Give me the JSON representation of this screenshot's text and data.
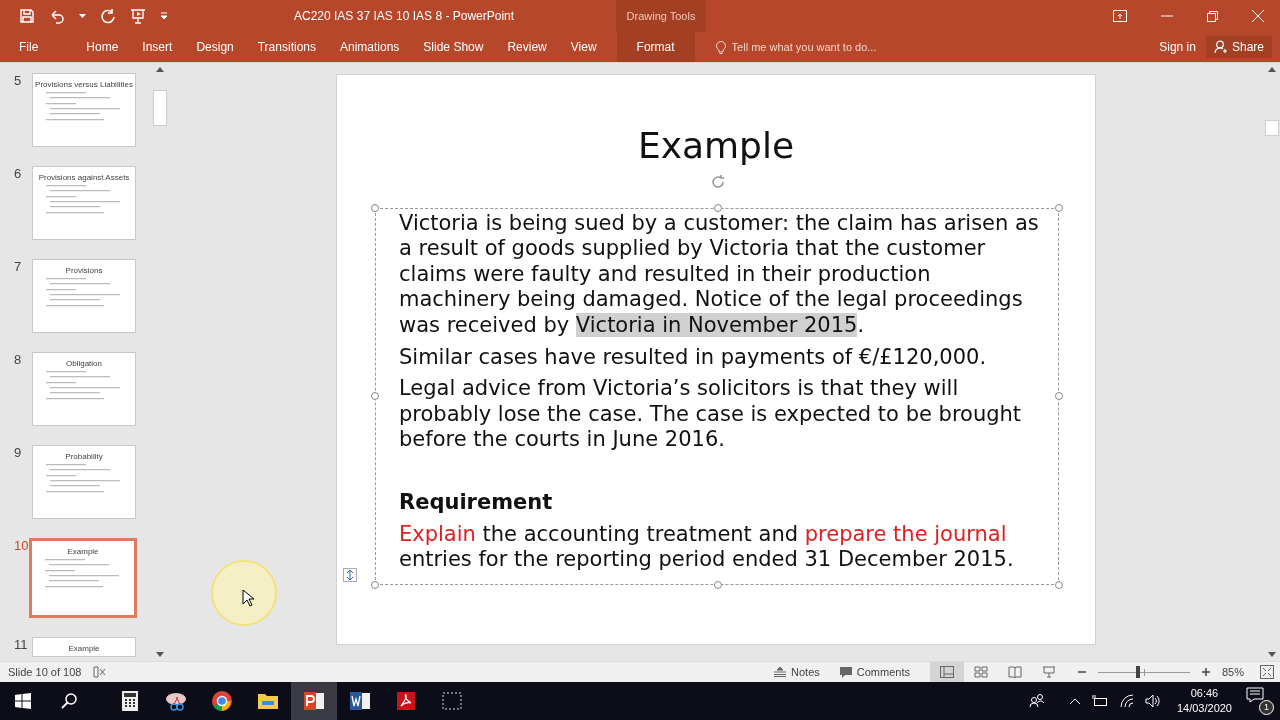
{
  "window": {
    "title": "AC220 IAS 37 IAS 10 IAS 8 - PowerPoint",
    "context_label": "Drawing Tools"
  },
  "ribbon_tabs": [
    {
      "label": "File",
      "selected": false
    },
    {
      "label": "Home",
      "selected": false
    },
    {
      "label": "Insert",
      "selected": false
    },
    {
      "label": "Design",
      "selected": false
    },
    {
      "label": "Transitions",
      "selected": false
    },
    {
      "label": "Animations",
      "selected": false
    },
    {
      "label": "Slide Show",
      "selected": false
    },
    {
      "label": "Review",
      "selected": false
    },
    {
      "label": "View",
      "selected": false
    },
    {
      "label": "Format",
      "selected": true
    }
  ],
  "tell_me": {
    "placeholder": "Tell me what you want to do..."
  },
  "sign_in": "Sign in",
  "share": "Share",
  "thumbnails": [
    {
      "number": "5",
      "title": "Provisions versus Liabilities",
      "selected": false
    },
    {
      "number": "6",
      "title": "Provisions against Assets",
      "selected": false
    },
    {
      "number": "7",
      "title": "Provisions",
      "selected": false
    },
    {
      "number": "8",
      "title": "Obligation",
      "selected": false
    },
    {
      "number": "9",
      "title": "Probability",
      "selected": false
    },
    {
      "number": "10",
      "title": "Example",
      "selected": true
    },
    {
      "number": "11",
      "title": "Example",
      "selected": false
    }
  ],
  "slide": {
    "title": "Example",
    "paragraphs": [
      {
        "kind": "body",
        "runs": [
          {
            "text": "Victoria is being sued by a customer: the claim has arisen as a result of goods supplied by Victoria that the customer claims were faulty and resulted in their production machinery being damaged. Notice of the legal proceedings was received by ",
            "kind": "plain"
          },
          {
            "text": "Victoria in November 2015",
            "kind": "highlight"
          },
          {
            "text": ".",
            "kind": "plain"
          }
        ]
      },
      {
        "kind": "body",
        "runs": [
          {
            "text": "Similar cases have resulted in payments of €/£120,000.",
            "kind": "plain"
          }
        ]
      },
      {
        "kind": "body",
        "runs": [
          {
            "text": "Legal advice from Victoria’s solicitors is that they will probably lose the case. The case is expected to be brought before the courts in June 2016.",
            "kind": "plain"
          }
        ]
      },
      {
        "kind": "heading",
        "runs": [
          {
            "text": "Requirement",
            "kind": "plain"
          }
        ]
      },
      {
        "kind": "body",
        "runs": [
          {
            "text": "Explain",
            "kind": "accent"
          },
          {
            "text": " the accounting treatment and ",
            "kind": "plain"
          },
          {
            "text": "prepare the journal",
            "kind": "accent"
          },
          {
            "text": " entries for the reporting period ended 31 December 2015.",
            "kind": "plain"
          }
        ]
      }
    ]
  },
  "status_bar": {
    "slide_info": "Slide 10 of 108",
    "notes": "Notes",
    "comments": "Comments",
    "zoom": {
      "level": 0.44,
      "reading": "85%"
    }
  },
  "taskbar": {
    "time": "06:46",
    "date": "14/03/2020",
    "notification_count": "1"
  }
}
